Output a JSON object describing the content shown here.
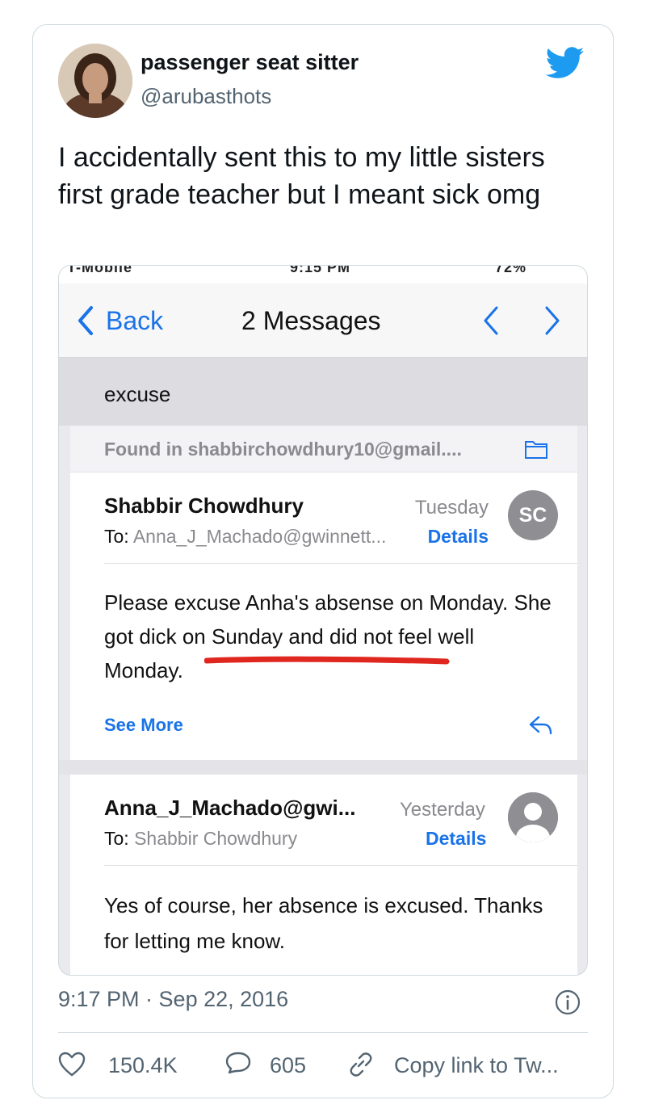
{
  "author": {
    "display_name": "passenger seat sitter",
    "handle": "@arubasthots",
    "avatar_icon": "profile-photo"
  },
  "tweet": {
    "text": "I accidentally sent this to my little sisters first grade teacher but I meant sick omg",
    "timestamp": "9:17 PM · Sep 22, 2016"
  },
  "actions": {
    "likes": "150.4K",
    "replies": "605",
    "copy_link": "Copy link to Tw..."
  },
  "mail_screenshot": {
    "status_left": "T-Mobile",
    "status_time": "9:15 PM",
    "status_battery": "72%",
    "nav": {
      "back_label": "Back",
      "title": "2 Messages"
    },
    "subject": "excuse",
    "found_in": "Found in shabbirchowdhury10@gmail....",
    "messages": [
      {
        "from": "Shabbir Chowdhury",
        "date": "Tuesday",
        "to_label": "To:",
        "to": "Anna_J_Machado@gwinnett...",
        "details": "Details",
        "initials": "SC",
        "body": "Please excuse Anha's absense on Monday. She got dick on Sunday and did not feel well Monday.",
        "see_more": "See More"
      },
      {
        "from": "Anna_J_Machado@gwi...",
        "date": "Yesterday",
        "to_label": "To:",
        "to": "Shabbir Chowdhury",
        "details": "Details",
        "body": "Yes of course, her absence is excused. Thanks for letting me know."
      }
    ],
    "highlight_color": "#e0271f"
  },
  "colors": {
    "twitter_blue": "#1d9bf0",
    "ios_blue": "#1a73e8",
    "secondary_text": "#536471"
  }
}
